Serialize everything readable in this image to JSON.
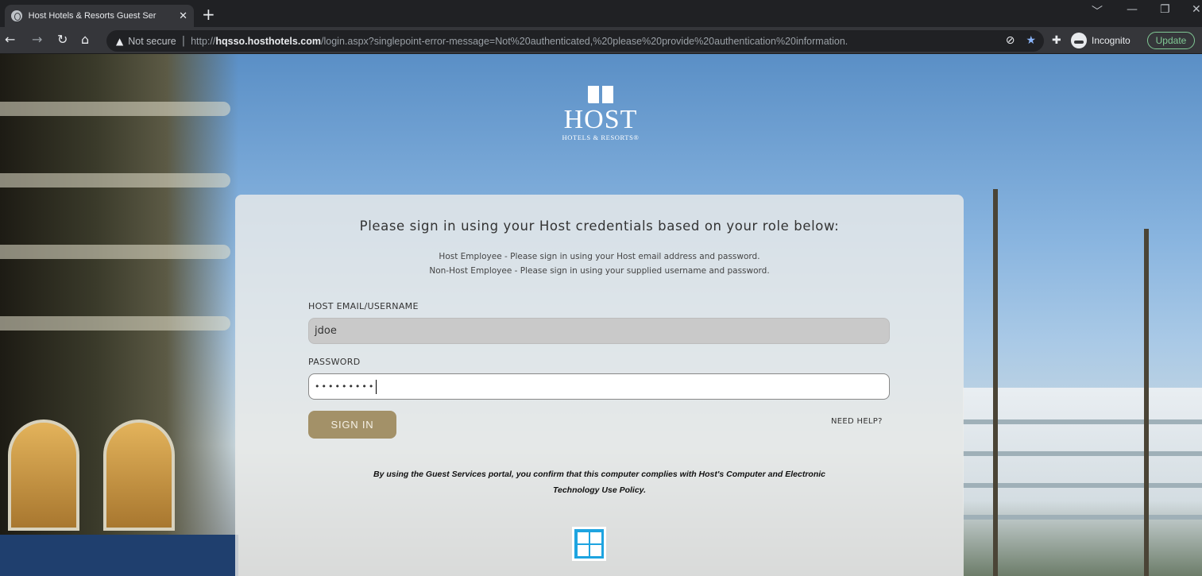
{
  "browser": {
    "tab_title": "Host Hotels & Resorts Guest Ser",
    "tab_close": "✕",
    "new_tab": "+",
    "security_label": "Not secure",
    "url_prefix": "http://",
    "url_host": "hqsso.hosthotels.com",
    "url_path": "/login.aspx?singlepoint-error-message=Not%20authenticated,%20please%20provide%20authentication%20information.",
    "incognito_label": "Incognito",
    "update_label": "Update"
  },
  "logo": {
    "word": "HOST",
    "subtitle": "HOTELS & RESORTS®"
  },
  "form": {
    "heading": "Please sign in using your Host credentials based on your role below:",
    "info_employee": "Host Employee - Please sign in using your Host email address and password.",
    "info_non_employee": "Non-Host Employee - Please sign in using your supplied username and password.",
    "username_label": "HOST EMAIL/USERNAME",
    "username_value": "jdoe",
    "password_label": "PASSWORD",
    "password_value": "•••••••••",
    "signin_label": "SIGN IN",
    "help_label": "NEED HELP?",
    "policy_line1": "By using the Guest Services portal, you confirm that this computer complies with Host's Computer and Electronic",
    "policy_line2": "Technology Use Policy."
  },
  "colors": {
    "signin_button": "#a39168",
    "windows_tile": "#1ea4e0",
    "update_button": "#81c995"
  },
  "icons": [
    "globe-icon",
    "close-icon",
    "plus-icon",
    "back-icon",
    "forward-icon",
    "reload-icon",
    "home-icon",
    "warning-icon",
    "eye-off-icon",
    "star-icon",
    "extensions-icon",
    "incognito-icon",
    "minimize-icon",
    "maximize-icon",
    "window-close-icon",
    "windows-logo-icon"
  ]
}
